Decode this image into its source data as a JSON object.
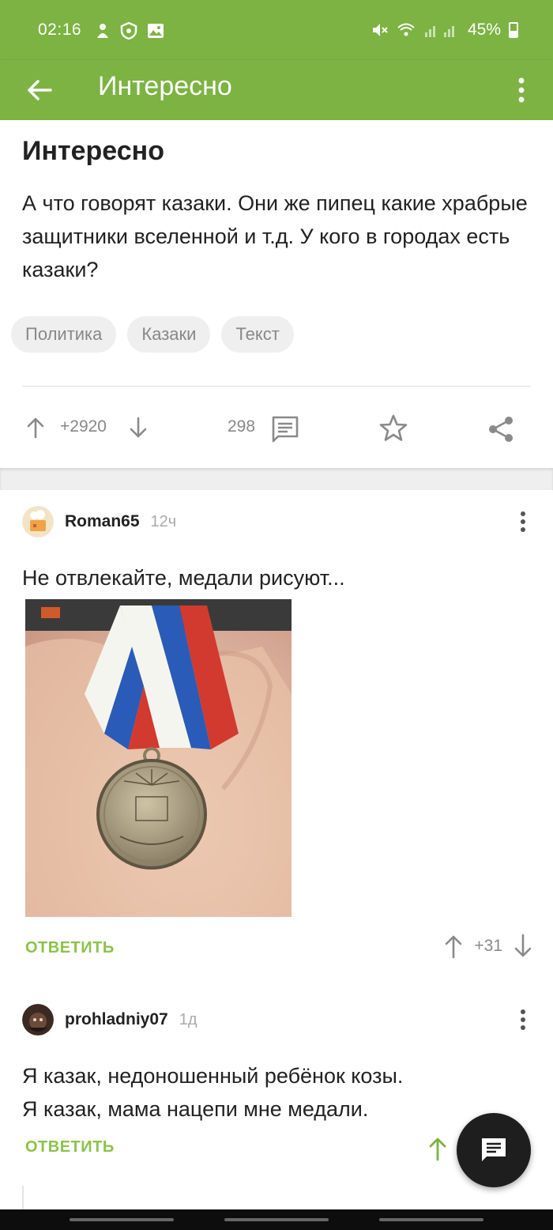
{
  "status_bar": {
    "time": "02:16",
    "battery": "45%"
  },
  "app_bar": {
    "title": "Интересно"
  },
  "post": {
    "title": "Интересно",
    "body": "А что говорят казаки. Они же пипец какие храбрые защитники вселенной и т.д. У кого в городах есть казаки?",
    "tags": [
      "Политика",
      "Казаки",
      "Текст"
    ],
    "rating": "+2920",
    "comments_count": "298"
  },
  "comments": [
    {
      "user": "Roman65",
      "time": "12ч",
      "text": "Не отвлекайте, медали рисуют...",
      "reply_label": "ОТВЕТИТЬ",
      "rating": "+31"
    },
    {
      "user": "prohladniy07",
      "time": "1д",
      "text_line1": "Я казак, недоношенный ребёнок козы.",
      "text_line2": "Я казак, мама нацепи мне медали.",
      "reply_label": "ОТВЕТИТЬ"
    }
  ],
  "colors": {
    "accent": "#7cb342",
    "reply": "#8bc34a",
    "fab": "#1e1e1e"
  },
  "icons": [
    "back-arrow-icon",
    "more-vert-icon",
    "arrow-up-icon",
    "arrow-down-icon",
    "comment-icon",
    "star-icon",
    "share-icon",
    "message-icon"
  ]
}
